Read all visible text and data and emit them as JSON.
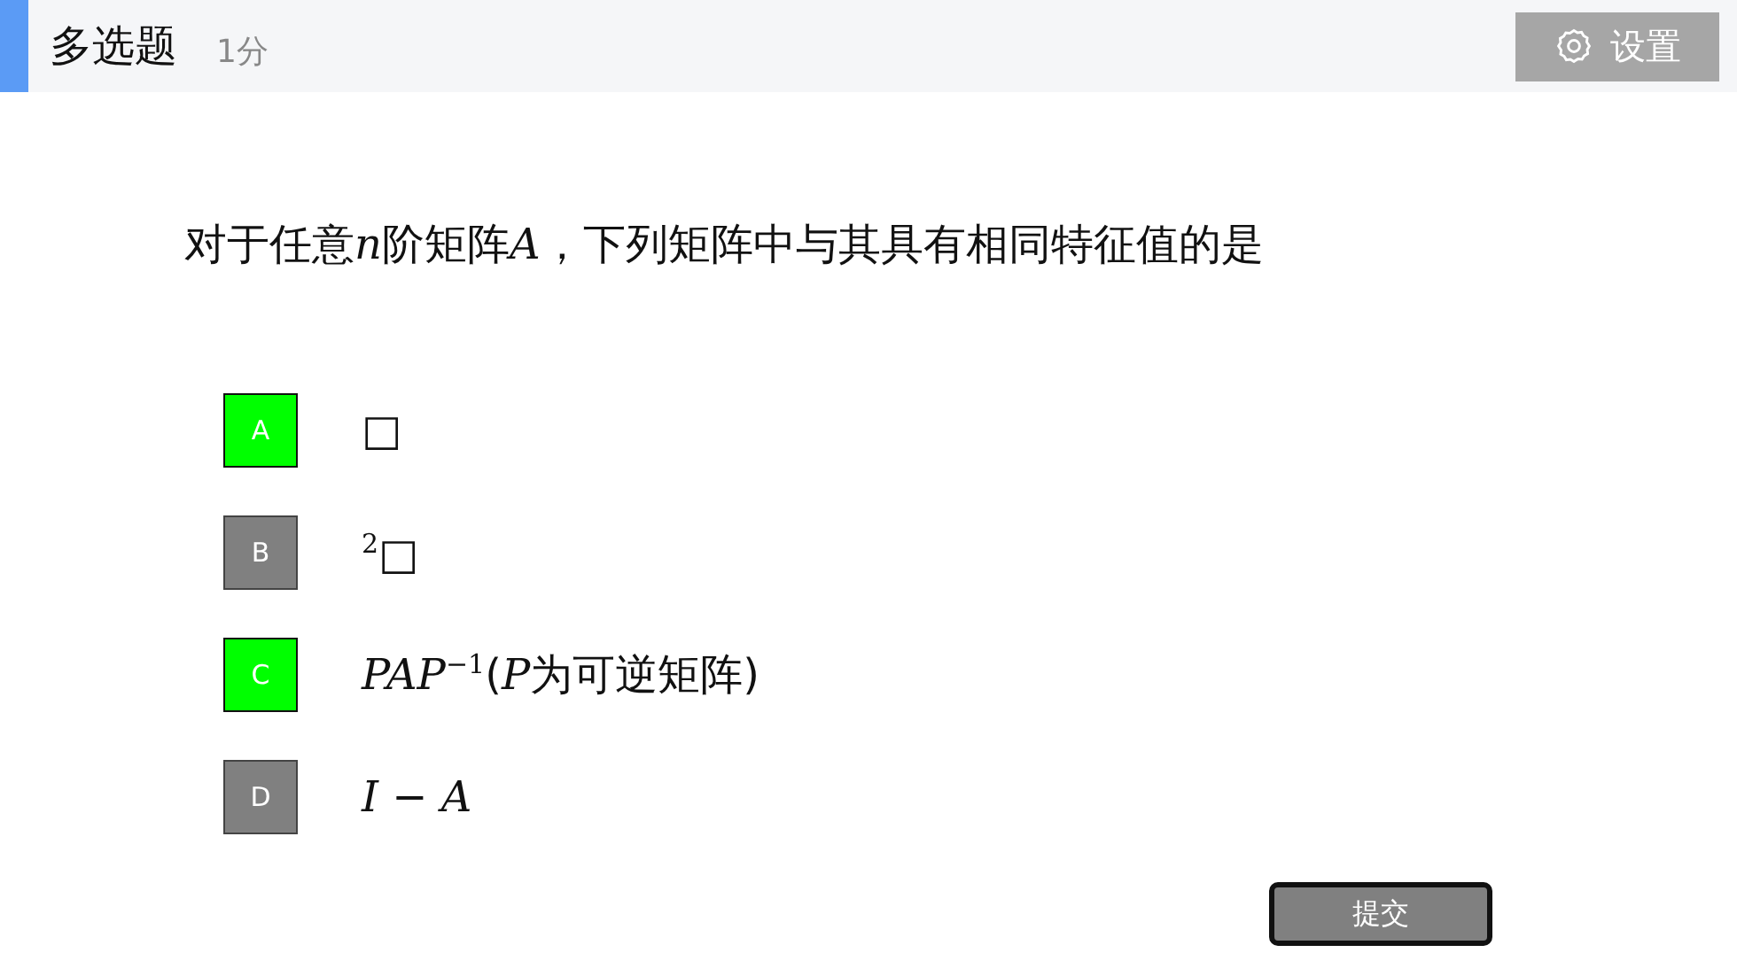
{
  "header": {
    "title": "多选题",
    "score": "1分",
    "settings_button": "设置"
  },
  "question": [
    {
      "kind": "text",
      "text": "对于任意"
    },
    {
      "kind": "var",
      "text": "n"
    },
    {
      "kind": "text",
      "text": "阶矩阵"
    },
    {
      "kind": "var",
      "text": "A"
    },
    {
      "kind": "text",
      "text": "，下列矩阵中与其具有相同特征值的是"
    }
  ],
  "options": [
    {
      "letter": "A",
      "selected": true,
      "text": [
        {
          "kind": "text",
          "text": "□"
        }
      ]
    },
    {
      "letter": "B",
      "selected": false,
      "text": [
        {
          "kind": "sup",
          "text": "2"
        },
        {
          "kind": "text",
          "text": "□"
        }
      ]
    },
    {
      "letter": "C",
      "selected": true,
      "text": [
        {
          "kind": "var",
          "text": "PAP"
        },
        {
          "kind": "sup",
          "text": "−1"
        },
        {
          "kind": "text",
          "text": "("
        },
        {
          "kind": "var",
          "text": "P"
        },
        {
          "kind": "text",
          "text": "为可逆矩阵)"
        }
      ]
    },
    {
      "letter": "D",
      "selected": false,
      "text": [
        {
          "kind": "var",
          "text": "I"
        },
        {
          "kind": "text",
          "text": " − "
        },
        {
          "kind": "var",
          "text": "A"
        }
      ]
    }
  ],
  "submit_button": "提交"
}
